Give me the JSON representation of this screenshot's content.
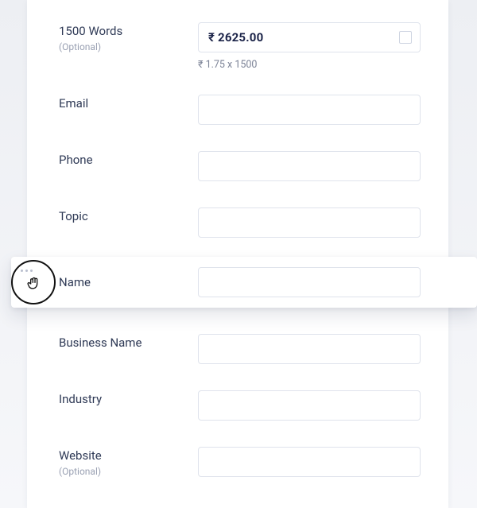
{
  "pricing": {
    "item_label": "1500 Words",
    "optional_label": "(Optional)",
    "price_display": "₹ 2625.00",
    "breakdown": "₹ 1.75 x 1500",
    "checked": false
  },
  "fields": {
    "email": {
      "label": "Email"
    },
    "phone": {
      "label": "Phone"
    },
    "topic": {
      "label": "Topic"
    },
    "name": {
      "label": "Name"
    },
    "business_name": {
      "label": "Business Name"
    },
    "industry": {
      "label": "Industry"
    },
    "website": {
      "label": "Website",
      "optional_label": "(Optional)"
    }
  }
}
